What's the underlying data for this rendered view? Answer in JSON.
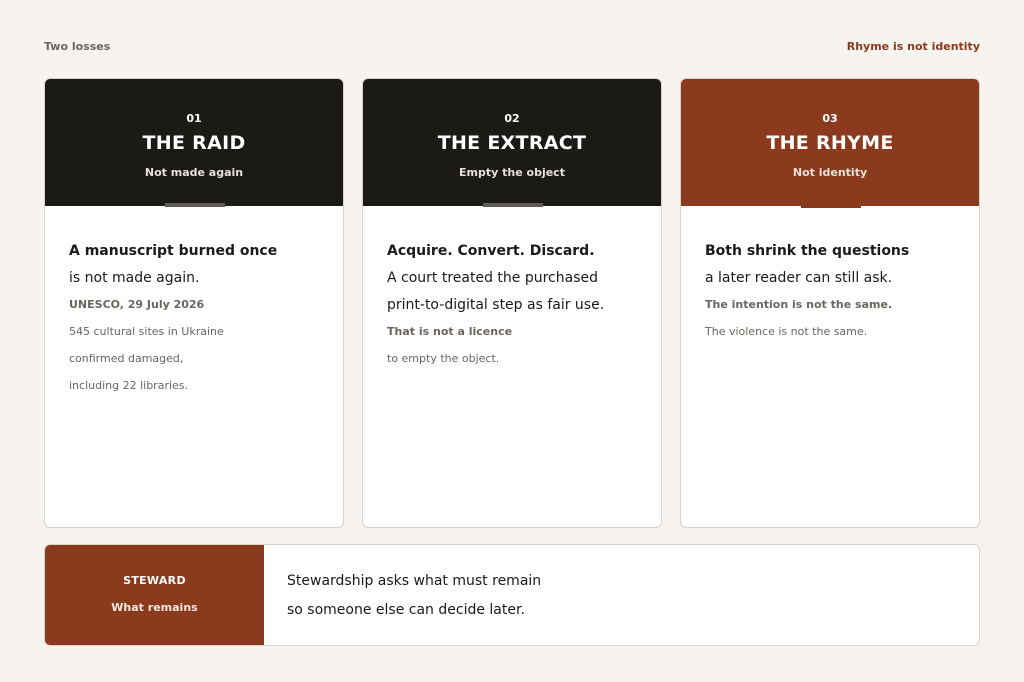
{
  "header": {
    "left_label": "Two losses",
    "right_label": "Rhyme is not identity"
  },
  "cards": [
    {
      "number": "01",
      "title": "THE RAID",
      "subtitle": "Not made again",
      "heading": "A manuscript burned once",
      "lead": "is not made again.",
      "meta": "UNESCO, 29 July 2026",
      "notes": [
        "545 cultural sites in Ukraine",
        "confirmed damaged,",
        "including 22 libraries."
      ]
    },
    {
      "number": "02",
      "title": "THE EXTRACT",
      "subtitle": "Empty the object",
      "heading": "Acquire. Convert. Discard.",
      "lead_lines": [
        "A court treated the purchased",
        "print-to-digital step as fair use."
      ],
      "meta": "That is not a licence",
      "notes": [
        "to empty the object."
      ]
    },
    {
      "number": "03",
      "title": "THE RHYME",
      "subtitle": "Not identity",
      "heading": "Both shrink the questions",
      "lead": "a later reader can still ask.",
      "meta": "The intention is not the same.",
      "notes": [
        "The violence is not the same."
      ]
    }
  ],
  "steward": {
    "title": "STEWARD",
    "subtitle": "What remains",
    "lines": [
      "Stewardship asks what must remain",
      "so someone else can decide later."
    ]
  },
  "colors": {
    "background": "#f7f3ee",
    "dark_header": "#1b1a17",
    "accent": "#8b3a1e"
  }
}
